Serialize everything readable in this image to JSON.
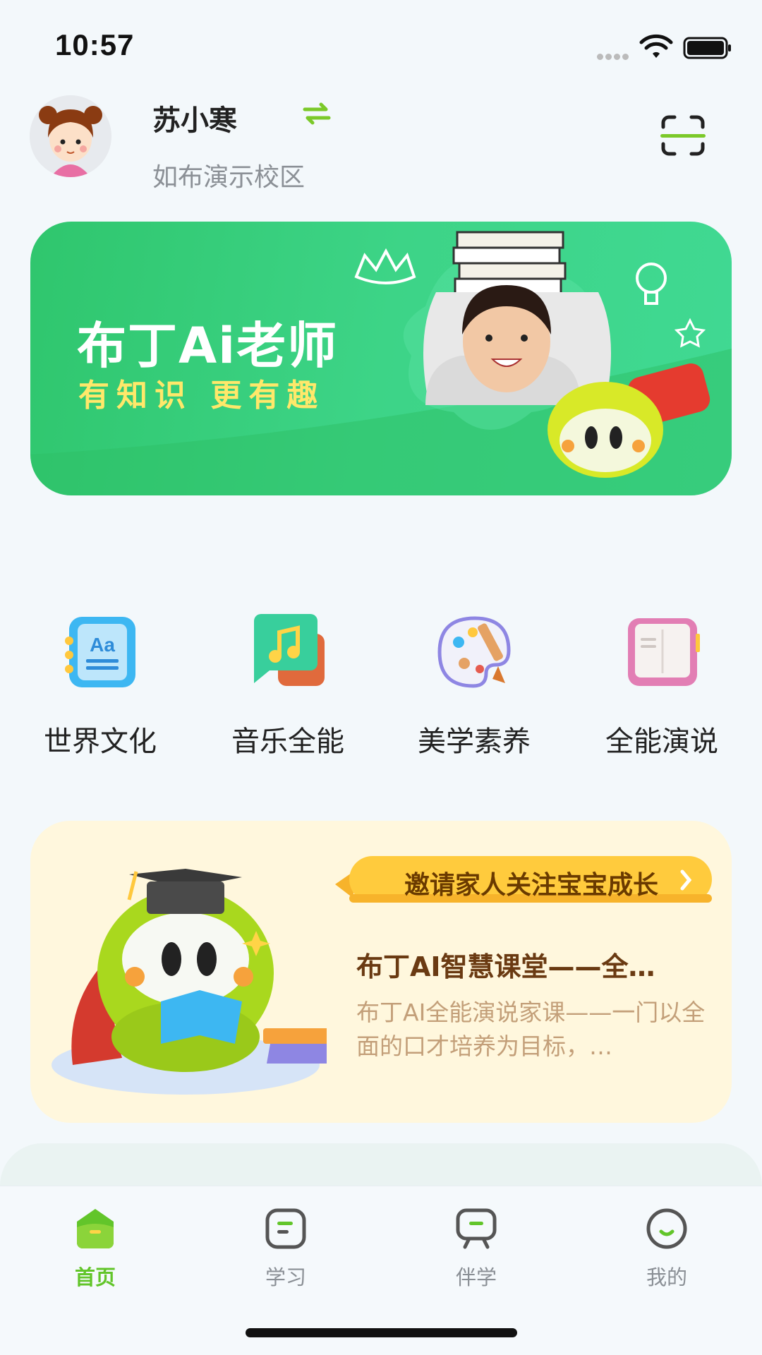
{
  "status": {
    "time": "10:57"
  },
  "header": {
    "user_name": "苏小寒",
    "campus": "如布演示校区"
  },
  "banner": {
    "title": "布丁Ai老师",
    "subtitle": "有知识 更有趣"
  },
  "categories": [
    {
      "label": "世界文化",
      "icon": "world-culture-icon"
    },
    {
      "label": "音乐全能",
      "icon": "music-icon"
    },
    {
      "label": "美学素养",
      "icon": "palette-icon"
    },
    {
      "label": "全能演说",
      "icon": "book-icon"
    }
  ],
  "promo": {
    "invite": "邀请家人关注宝宝成长",
    "title": "布丁AI智慧课堂——全…",
    "desc": "布丁AI全能演说家课——一门以全面的口才培养为目标，…"
  },
  "tabs": [
    {
      "label": "首页",
      "active": true
    },
    {
      "label": "学习",
      "active": false
    },
    {
      "label": "伴学",
      "active": false
    },
    {
      "label": "我的",
      "active": false
    }
  ],
  "colors": {
    "accent": "#62C52A",
    "banner_green": "#3DD487",
    "promo_bg": "#FFF7DD",
    "invite_yellow": "#FFCB3D"
  }
}
